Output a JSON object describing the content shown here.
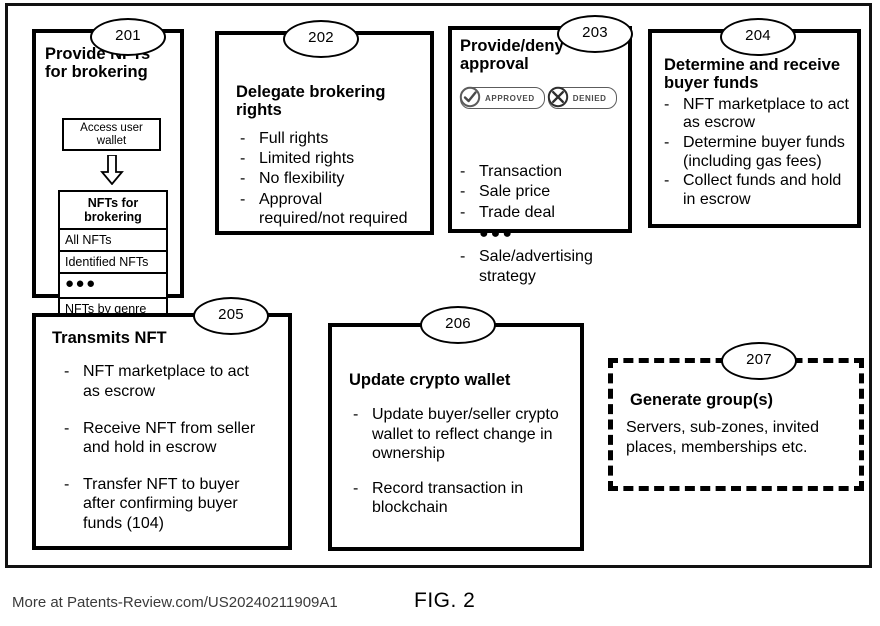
{
  "figure": {
    "label": "FIG. 2",
    "credit": "More at Patents-Review.com/US20240211909A1"
  },
  "boxes": {
    "b201": {
      "number": "201",
      "title": "Provide NFTs\nfor brokering",
      "subbox": "Access user\nwallet",
      "arrow_icon": "down-arrow-icon",
      "table": {
        "header": "NFTs for\nbrokering",
        "rows": [
          "All NFTs",
          "Identified NFTs",
          "●●●",
          "NFTs by genre"
        ]
      }
    },
    "b202": {
      "number": "202",
      "title": "Delegate brokering rights",
      "items": [
        "Full rights",
        "Limited rights",
        "No flexibility",
        "Approval\nrequired/not required"
      ]
    },
    "b203": {
      "number": "203",
      "title": "Provide/deny\napproval",
      "badges": [
        {
          "label": "APPROVED",
          "icon": "check-circle-icon"
        },
        {
          "label": "DENIED",
          "icon": "x-circle-icon"
        }
      ],
      "items": [
        {
          "text": "Transaction",
          "dash": true
        },
        {
          "text": "Sale price",
          "dash": true
        },
        {
          "text": "Trade deal",
          "dash": true
        },
        {
          "text": "●●●",
          "dash": false,
          "ellipsis": true
        },
        {
          "text": "Sale/advertising\nstrategy",
          "dash": true
        }
      ]
    },
    "b204": {
      "number": "204",
      "title": "Determine and receive\nbuyer funds",
      "items": [
        "NFT marketplace to act\nas escrow",
        "Determine buyer funds\n(including gas fees)",
        "Collect funds and hold\nin escrow"
      ]
    },
    "b205": {
      "number": "205",
      "title": "Transmits NFT",
      "items": [
        "NFT marketplace to act\nas escrow",
        "Receive NFT from seller\nand hold in escrow",
        "Transfer NFT to buyer\nafter confirming buyer\nfunds (104)"
      ]
    },
    "b206": {
      "number": "206",
      "title": "Update crypto wallet",
      "items": [
        "Update buyer/seller crypto\nwallet to reflect change in\nownership",
        "Record transaction in\nblockchain"
      ]
    },
    "b207": {
      "number": "207",
      "title": "Generate group(s)",
      "body": "Servers, sub-zones, invited\nplaces, memberships etc."
    }
  }
}
